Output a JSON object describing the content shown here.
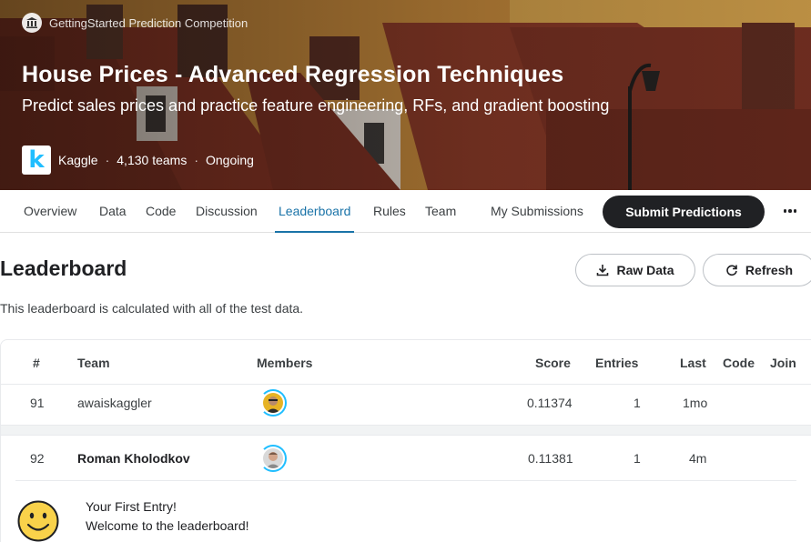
{
  "hero": {
    "competition_type": "GettingStarted Prediction Competition",
    "title": "House Prices - Advanced Regression Techniques",
    "subtitle": "Predict sales prices and practice feature engineering, RFs, and gradient boosting",
    "host_logo_letter": "k",
    "host": "Kaggle",
    "teams": "4,130 teams",
    "status": "Ongoing",
    "separator": "·"
  },
  "nav": {
    "tabs": [
      "Overview",
      "Data",
      "Code",
      "Discussion",
      "Leaderboard",
      "Rules",
      "Team",
      "My Submissions"
    ],
    "active_tab": "Leaderboard",
    "submit_label": "Submit Predictions"
  },
  "leaderboard": {
    "title": "Leaderboard",
    "description": "This leaderboard is calculated with all of the test data.",
    "raw_data_label": "Raw Data",
    "refresh_label": "Refresh",
    "columns": [
      "#",
      "Team",
      "Members",
      "Score",
      "Entries",
      "Last",
      "Code",
      "Join"
    ],
    "rows": [
      {
        "rank": "91",
        "team": "awaiskaggler",
        "score": "0.11374",
        "entries": "1",
        "last": "1mo"
      },
      {
        "rank": "92",
        "team": "Roman Kholodkov",
        "score": "0.11381",
        "entries": "1",
        "last": "4m"
      }
    ],
    "welcome_line1": "Your First Entry!",
    "welcome_line2": "Welcome to the leaderboard!"
  },
  "colors": {
    "accent": "#1a73a8",
    "kaggle_blue": "#20beff",
    "dark_button": "#202124"
  },
  "icons": [
    "bank-icon",
    "kaggle-logo",
    "download-icon",
    "refresh-icon",
    "more-icon",
    "smiley-icon"
  ]
}
